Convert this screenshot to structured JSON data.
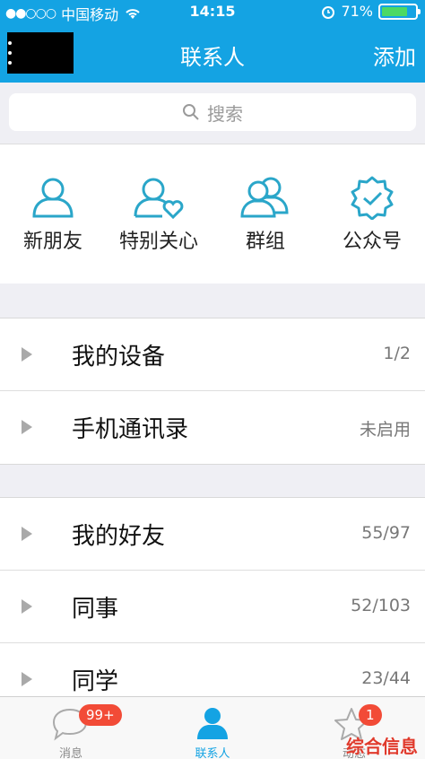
{
  "status_bar": {
    "carrier": "中国移动",
    "time": "14:15",
    "battery": "71%"
  },
  "nav": {
    "title": "联系人",
    "add_label": "添加"
  },
  "search": {
    "placeholder": "搜索"
  },
  "quick_entries": [
    {
      "label": "新朋友",
      "icon": "user-icon"
    },
    {
      "label": "特别关心",
      "icon": "user-heart-icon"
    },
    {
      "label": "群组",
      "icon": "group-icon"
    },
    {
      "label": "公众号",
      "icon": "badge-check-icon"
    }
  ],
  "group1": [
    {
      "name": "我的设备",
      "count": "1/2"
    },
    {
      "name": "手机通讯录",
      "count": "未启用"
    }
  ],
  "group2": [
    {
      "name": "我的好友",
      "count": "55/97"
    },
    {
      "name": "同事",
      "count": "52/103"
    },
    {
      "name": "同学",
      "count": "23/44"
    }
  ],
  "tabs": [
    {
      "label": "消息",
      "badge": "99+"
    },
    {
      "label": "联系人"
    },
    {
      "label": "动态",
      "badge": "1"
    }
  ],
  "watermark": "综合信息",
  "colors": {
    "accent": "#14a3e3",
    "badge": "#f24b37",
    "icon_teal": "#2aa6c9"
  }
}
